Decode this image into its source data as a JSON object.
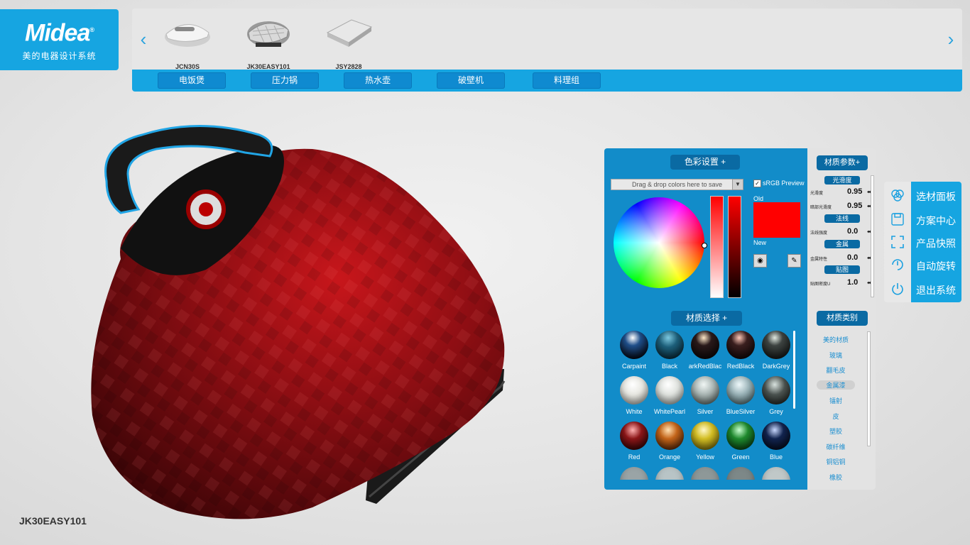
{
  "logo": {
    "brand": "Midea",
    "reg": "®",
    "subtitle": "美的电器设计系统"
  },
  "products": [
    {
      "name": "JCN30S"
    },
    {
      "name": "JK30EASY101"
    },
    {
      "name": "JSY2828"
    }
  ],
  "categories": [
    "电饭煲",
    "压力锅",
    "热水壶",
    "破壁机",
    "料理组"
  ],
  "model_label": "JK30EASY101",
  "color_panel": {
    "title": "色彩设置 +",
    "swatch_placeholder": "Drag & drop colors here to save",
    "srgb_label": "sRGB Preview",
    "old_label": "Old",
    "new_label": "New",
    "current_color": "#ff0000"
  },
  "material_select": {
    "title": "材质选择 +",
    "materials": [
      {
        "name": "Carpaint",
        "color": "#1f4f8a"
      },
      {
        "name": "Black",
        "color": "#1d5f7a"
      },
      {
        "name": "arkRedBlac",
        "color": "#2a1a1a"
      },
      {
        "name": "RedBlack",
        "color": "#3a1f1f"
      },
      {
        "name": "DarkGrey",
        "color": "#3d4341"
      },
      {
        "name": "White",
        "color": "#e8e8e2"
      },
      {
        "name": "WhitePearl",
        "color": "#e0e3df"
      },
      {
        "name": "Silver",
        "color": "#aab6b4"
      },
      {
        "name": "BlueSilver",
        "color": "#9ab3b8"
      },
      {
        "name": "Grey",
        "color": "#4b5350"
      },
      {
        "name": "Red",
        "color": "#8c1618"
      },
      {
        "name": "Orange",
        "color": "#c4651a"
      },
      {
        "name": "Yellow",
        "color": "#d3be24"
      },
      {
        "name": "Green",
        "color": "#1f8a2e"
      },
      {
        "name": "Blue",
        "color": "#12244f"
      }
    ]
  },
  "material_params": {
    "title": "材质参数+",
    "groups": [
      {
        "header": "光滑度",
        "rows": [
          {
            "label": "光滑度",
            "value": "0.95"
          },
          {
            "label": "暗部光滑度",
            "value": "0.95"
          }
        ]
      },
      {
        "header": "法线",
        "rows": [
          {
            "label": "法线强度",
            "value": "0.0"
          }
        ]
      },
      {
        "header": "金属",
        "rows": [
          {
            "label": "金属特性",
            "value": "0.0"
          }
        ]
      },
      {
        "header": "贴图",
        "rows": [
          {
            "label": "贴图密度U",
            "value": "1.0"
          }
        ]
      }
    ]
  },
  "material_categories": {
    "title": "材质类别",
    "items": [
      "美的材质",
      "玻璃",
      "翻毛皮",
      "金属漆",
      "镭射",
      "皮",
      "塑胶",
      "碳纤维",
      "铜铝铜",
      "橡胶"
    ],
    "selected": "金属漆"
  },
  "right_menu": [
    {
      "label": "选材面板",
      "icon": "material-panel-icon"
    },
    {
      "label": "方案中心",
      "icon": "save-icon"
    },
    {
      "label": "产品快照",
      "icon": "snapshot-icon"
    },
    {
      "label": "自动旋转",
      "icon": "rotate-icon"
    },
    {
      "label": "退出系统",
      "icon": "power-icon"
    }
  ],
  "appliance_label": "Midea"
}
